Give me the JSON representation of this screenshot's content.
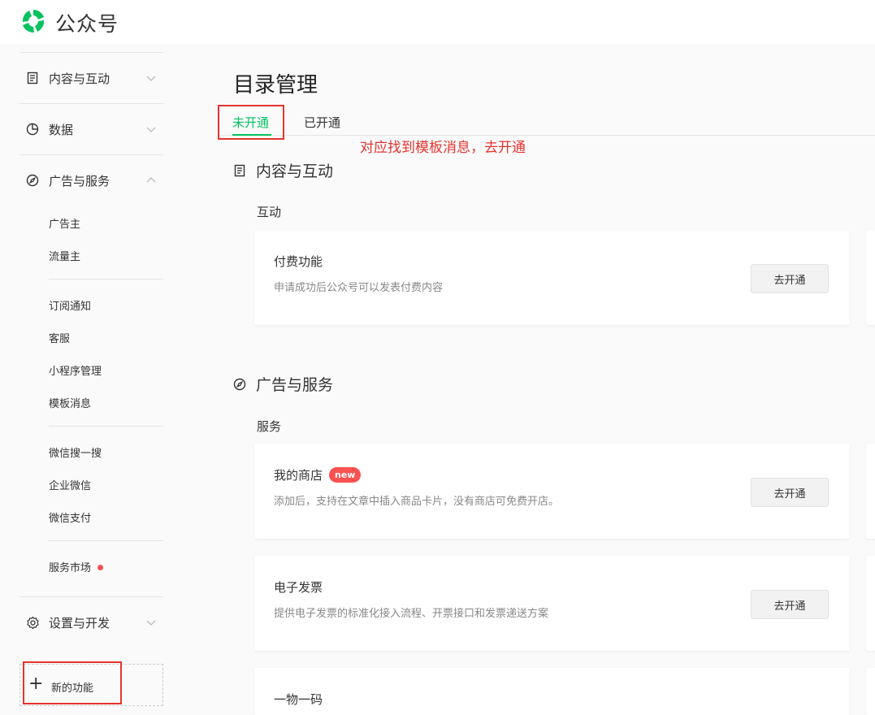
{
  "app": {
    "title": "公众号"
  },
  "sidebar": {
    "groups": [
      {
        "label": "内容与互动",
        "icon": "document-icon",
        "expanded": false
      },
      {
        "label": "数据",
        "icon": "pie-chart-icon",
        "expanded": false
      },
      {
        "label": "广告与服务",
        "icon": "compass-icon",
        "expanded": true
      },
      {
        "label": "设置与开发",
        "icon": "gear-icon",
        "expanded": false
      }
    ],
    "ad_service_items": [
      "广告主",
      "流量主",
      "订阅通知",
      "客服",
      "小程序管理",
      "模板消息",
      "微信搜一搜",
      "企业微信",
      "微信支付",
      "服务市场"
    ],
    "new_function_label": "新的功能"
  },
  "main": {
    "title": "目录管理",
    "tabs": [
      {
        "label": "未开通",
        "active": true
      },
      {
        "label": "已开通",
        "active": false
      }
    ],
    "annotation": "对应找到模板消息，去开通",
    "sections": [
      {
        "title": "内容与互动",
        "icon": "document-icon",
        "groups": [
          {
            "label": "互动",
            "cards": [
              {
                "title": "付费功能",
                "description": "申请成功后公众号可以发表付费内容",
                "button": "去开通"
              }
            ]
          }
        ]
      },
      {
        "title": "广告与服务",
        "icon": "compass-icon",
        "groups": [
          {
            "label": "服务",
            "cards": [
              {
                "title": "我的商店",
                "badge": "new",
                "description": "添加后，支持在文章中插入商品卡片，没有商店可免费开店。",
                "button": "去开通"
              },
              {
                "title": "电子发票",
                "description": "提供电子发票的标准化接入流程、开票接口和发票递送方案",
                "button": "去开通"
              },
              {
                "title": "一物一码"
              }
            ]
          }
        ]
      }
    ]
  },
  "colors": {
    "accent": "#07c160",
    "annotation": "#e5342f",
    "badge": "#fa5151"
  }
}
